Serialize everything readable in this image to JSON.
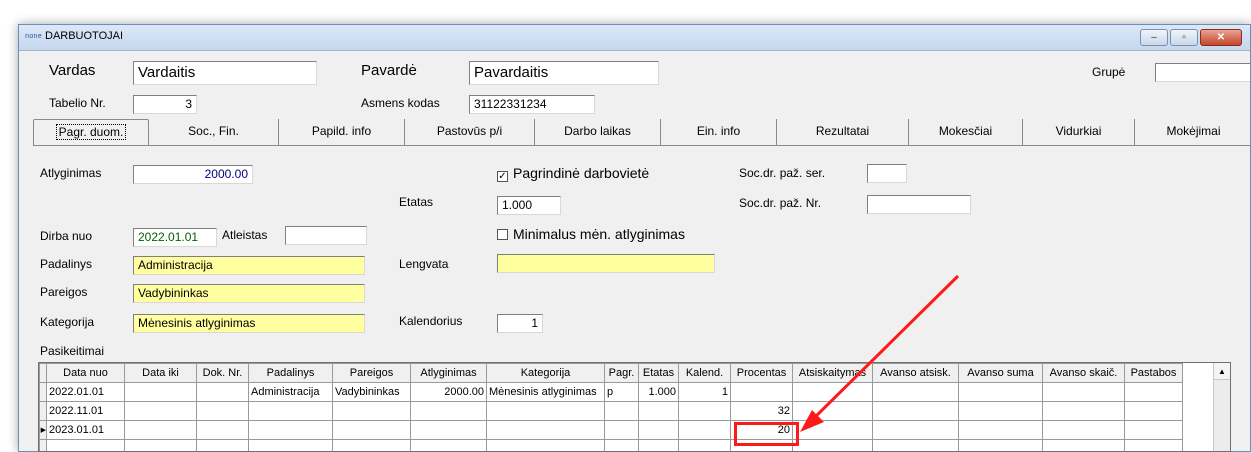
{
  "window": {
    "icon_text": "none",
    "title": "DARBUOTOJAI",
    "buttons": {
      "minimize": "–",
      "maximize": "▫",
      "close": "✕"
    }
  },
  "header": {
    "vardas_label": "Vardas",
    "vardas_value": "Vardaitis",
    "pavarde_label": "Pavardė",
    "pavarde_value": "Pavardaitis",
    "grupe_label": "Grupė",
    "grupe_value": "",
    "tabelio_label": "Tabelio Nr.",
    "tabelio_value": "3",
    "asmens_label": "Asmens kodas",
    "asmens_value": "31122331234"
  },
  "tabs": [
    "Pagr. duom.",
    "Soc., Fin.",
    "Papild. info",
    "Pastovūs p/i",
    "Darbo laikas",
    "Ein. info",
    "Rezultatai",
    "Mokesčiai",
    "Vidurkiai",
    "Mokėjimai"
  ],
  "form": {
    "atlyginimas_label": "Atlyginimas",
    "atlyginimas_value": "2000.00",
    "pagrindine_label": "Pagrindinė darbovietė",
    "pagrindine_checked": "☑",
    "socdr_ser_label": "Soc.dr. paž. ser.",
    "socdr_ser_value": "",
    "etatas_label": "Etatas",
    "etatas_value": "1.000",
    "socdr_nr_label": "Soc.dr. paž. Nr.",
    "socdr_nr_value": "",
    "dirba_nuo_label": "Dirba nuo",
    "dirba_nuo_value": "2022.01.01",
    "atleistas_label": "Atleistas",
    "atleistas_value": "",
    "minimalus_label": "Minimalus mėn. atlyginimas",
    "padalinys_label": "Padalinys",
    "padalinys_value": "Administracija",
    "lengvata_label": "Lengvata",
    "lengvata_value": "",
    "pareigos_label": "Pareigos",
    "pareigos_value": "Vadybininkas",
    "kategorija_label": "Kategorija",
    "kategorija_value": "Mėnesinis atlyginimas",
    "kalendorius_label": "Kalendorius",
    "kalendorius_value": "1",
    "pasikeitimai_label": "Pasikeitimai"
  },
  "grid": {
    "columns": [
      "Data nuo",
      "Data iki",
      "Dok. Nr.",
      "Padalinys",
      "Pareigos",
      "Atlyginimas",
      "Kategorija",
      "Pagr.",
      "Etatas",
      "Kalend.",
      "Procentas",
      "Atsiskaitymas",
      "Avanso atsisk.",
      "Avanso suma",
      "Avanso skaič.",
      "Pastabos"
    ],
    "rows": [
      [
        "2022.01.01",
        "",
        "",
        "Administracija",
        "Vadybininkas",
        "2000.00",
        "Mėnesinis atlyginimas",
        "p",
        "1.000",
        "1",
        "",
        "",
        "",
        "",
        "",
        ""
      ],
      [
        "2022.11.01",
        "",
        "",
        "",
        "",
        "",
        "",
        "",
        "",
        "",
        "32",
        "",
        "",
        "",
        "",
        ""
      ],
      [
        "2023.01.01",
        "",
        "",
        "",
        "",
        "",
        "",
        "",
        "",
        "",
        "20",
        "",
        "",
        "",
        "",
        ""
      ]
    ],
    "current_row_marker": "▶",
    "scroll_up": "▲"
  },
  "annotation": {
    "color": "#ff1a1a"
  }
}
